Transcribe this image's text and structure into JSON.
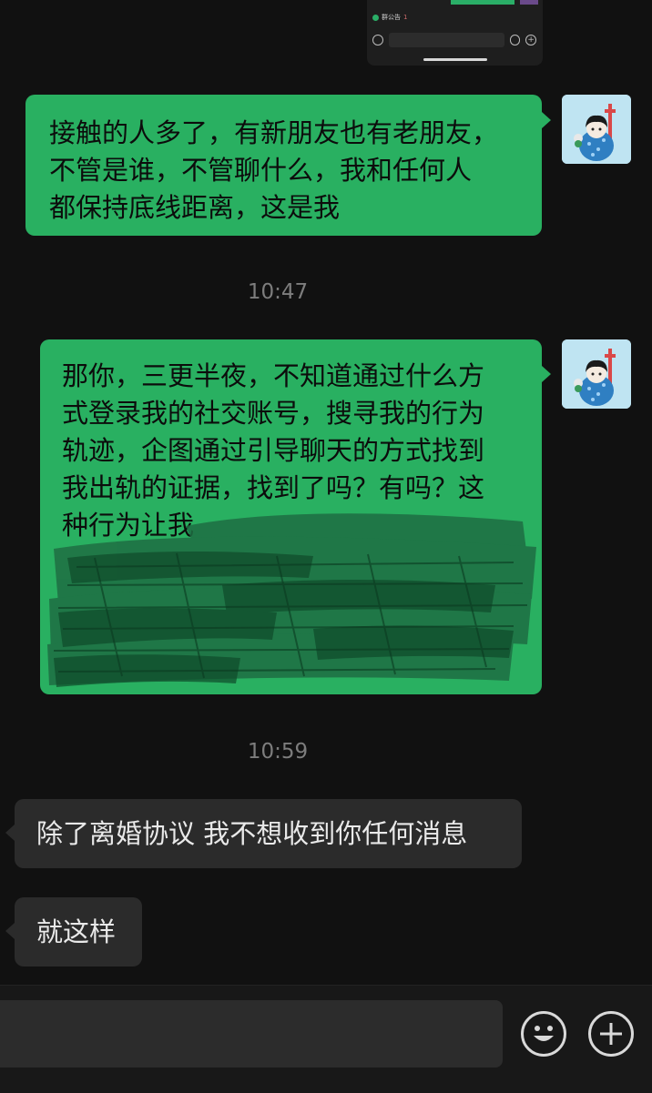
{
  "thumbnail": {
    "notice_label": "群公告",
    "notice_count": "1",
    "plus_glyph": "+"
  },
  "messages": [
    {
      "direction": "out",
      "lines": [
        "接触的人多了，有新朋友也有老朋友，",
        "不管是谁，不管聊什么，我和任何人",
        "都保持底线距离，这是我"
      ]
    },
    {
      "timestamp": "10:47"
    },
    {
      "direction": "out",
      "lines": [
        "那你，三更半夜，不知道通过什么方",
        "式登录我的社交账号，搜寻我的行为",
        "轨迹，企图通过引导聊天的方式找到",
        "我出轨的证据，找到了吗？有吗？这",
        "种行为让我"
      ],
      "obscured_by_scribble": true
    },
    {
      "timestamp": "10:59"
    },
    {
      "direction": "in",
      "text": "除了离婚协议 我不想收到你任何消息"
    },
    {
      "direction": "in",
      "text": "就这样"
    }
  ],
  "input_bar": {
    "emoji_icon": "smiley-face-icon",
    "more_icon": "plus-circle-icon"
  },
  "colors": {
    "background": "#111111",
    "outgoing_bubble": "#29b061",
    "incoming_bubble": "#2b2b2b",
    "timestamp": "#7d7d7d",
    "avatar_bg": "#bfe4f2"
  }
}
